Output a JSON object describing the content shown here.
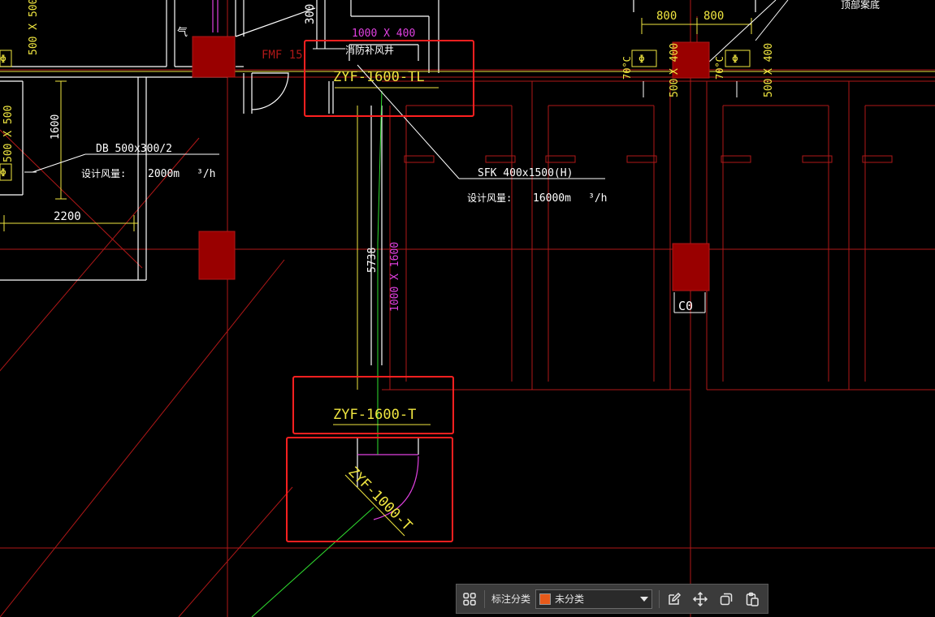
{
  "colors": {
    "wall": "#ffffff",
    "grid_red": "#b01818",
    "column_fill": "#990000",
    "highlight_box": "#ff2020",
    "yellow_text": "#f0e640",
    "magenta_text": "#e040e0",
    "green_duct": "#30e030",
    "swatch_orange": "#e85a1a"
  },
  "labels": {
    "top_dim_left": "800",
    "top_dim_right": "800",
    "dim_300": "300",
    "dim_500x500_top_left": "500 X 500",
    "dim_500x500_left": "500 X 500",
    "dim_1600": "1600",
    "dim_2200": "2200",
    "fmf": "FMF 15",
    "qi": "气",
    "duct_size_top": "1000 X 400",
    "shaft_label": "消防补风井",
    "zyf_top": "ZYF-1600-TL",
    "db_label": "DB 500x300/2",
    "db_flow_label": "设计风量:",
    "db_flow_value": "2000m",
    "db_flow_unit": "³/h",
    "sfk_label": "SFK 400x1500(H)",
    "sfk_flow_label": "设计风量:",
    "sfk_flow_value": "16000m",
    "sfk_flow_unit": "³/h",
    "dim_5738": "5738",
    "duct_size_vertical": "1000 X 1600",
    "c0": "C0",
    "zyf_mid": "ZYF-1600-T",
    "zyf_diag": "ZYF-1000-T",
    "temp_70_a": "70°C",
    "temp_70_b": "70°C",
    "dim_500_a": "500",
    "dim_500_b": "500",
    "dim_x400_a": "X 400",
    "dim_x400_b": "X 400",
    "top_right_text": "顶部案底"
  },
  "toolbar": {
    "group_icon": "grid-icon",
    "category_label": "标注分类",
    "category_value": "未分类",
    "edit_icon": "edit-icon",
    "move_icon": "move-icon",
    "copy_icon": "copy-icon",
    "paste_icon": "paste-icon"
  }
}
